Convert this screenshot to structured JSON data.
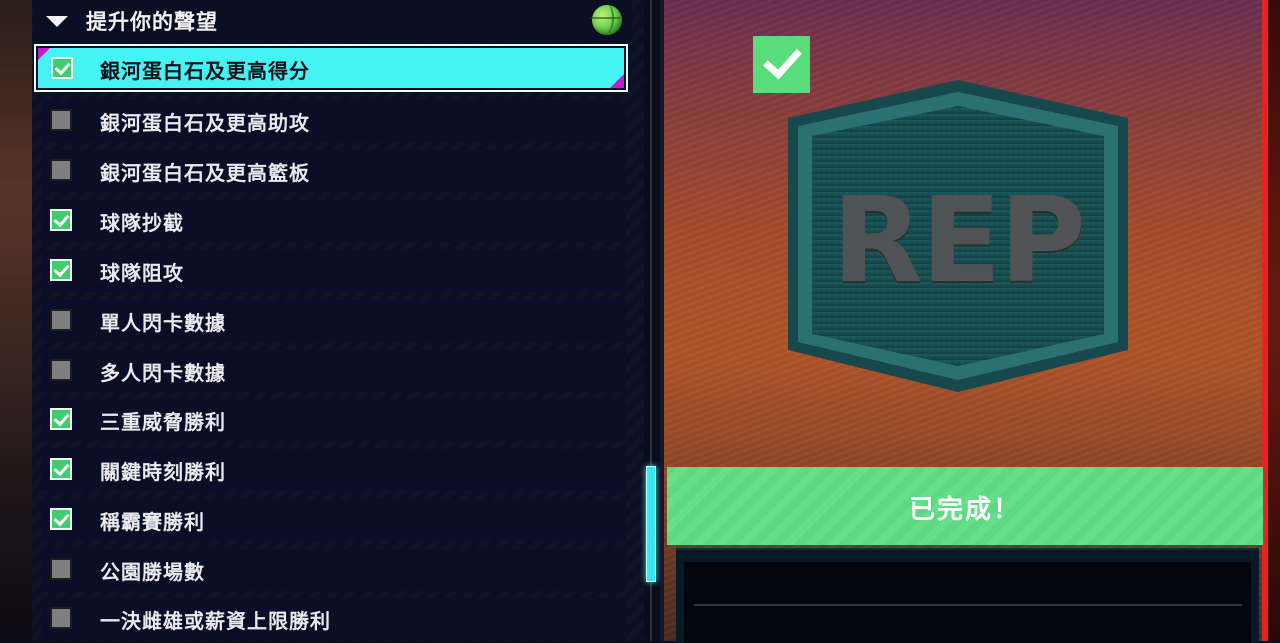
{
  "section": {
    "title": "提升你的聲望",
    "expand_icon": "triangle-down-icon",
    "badge_icon": "basketball-icon"
  },
  "tasks": [
    {
      "label": "銀河蛋白石及更高得分",
      "checked": true,
      "selected": true
    },
    {
      "label": "銀河蛋白石及更高助攻",
      "checked": false
    },
    {
      "label": "銀河蛋白石及更高籃板",
      "checked": false
    },
    {
      "label": "球隊抄截",
      "checked": true
    },
    {
      "label": "球隊阻攻",
      "checked": true
    },
    {
      "label": "單人閃卡數據",
      "checked": false
    },
    {
      "label": "多人閃卡數據",
      "checked": false
    },
    {
      "label": "三重威脅勝利",
      "checked": true
    },
    {
      "label": "關鍵時刻勝利",
      "checked": true
    },
    {
      "label": "稱霸賽勝利",
      "checked": true
    },
    {
      "label": "公園勝場數",
      "checked": false
    },
    {
      "label": "一決雌雄或薪資上限勝利",
      "checked": false
    }
  ],
  "detail": {
    "badge_text": "REP",
    "status_label": "已完成！",
    "completed": true
  },
  "colors": {
    "selected_row": "#45f2f4",
    "check_green": "#3fcd6e",
    "complete_bar": "#5fd883",
    "accent_magenta": "#c21cd0",
    "accent_red": "#e62222"
  }
}
